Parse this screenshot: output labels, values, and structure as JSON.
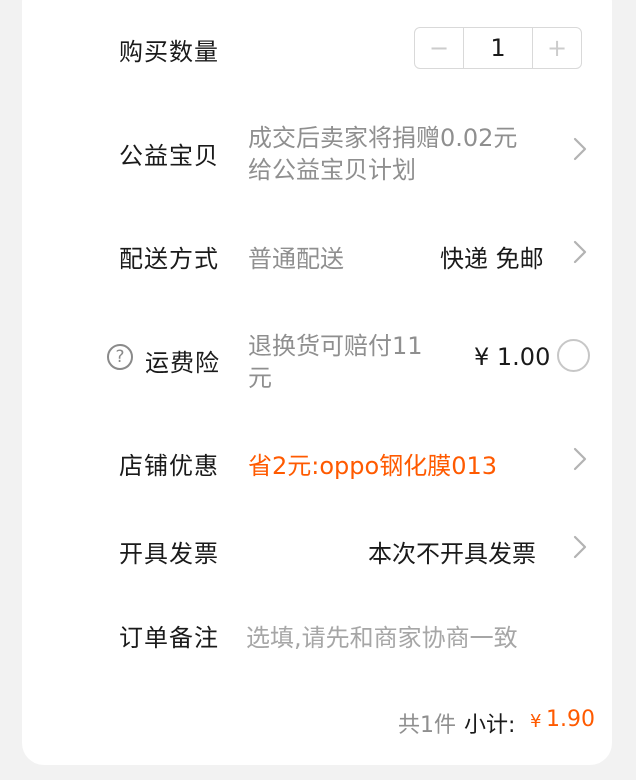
{
  "quantity_row": {
    "label": "购买数量",
    "minus": "−",
    "value": "1",
    "plus": "+"
  },
  "charity_row": {
    "label": "公益宝贝",
    "line1": "成交后卖家将捐赠0.02元",
    "line2": "给公益宝贝计划"
  },
  "delivery_row": {
    "label": "配送方式",
    "method": "普通配送",
    "value": "快递 免邮"
  },
  "insurance_row": {
    "label": "运费险",
    "help_icon": "?",
    "line1": "退换货可赔付11",
    "line2": "元",
    "price": "¥ 1.00",
    "selected": false
  },
  "discount_row": {
    "label": "店铺优惠",
    "value": "省2元:oppo钢化膜013"
  },
  "invoice_row": {
    "label": "开具发票",
    "value": "本次不开具发票"
  },
  "note_row": {
    "label": "订单备注",
    "placeholder": "选填,请先和商家协商一致"
  },
  "summary": {
    "count": "共1件",
    "subtotal_label": "小计:",
    "currency": "¥",
    "amount": "1.90"
  },
  "colors": {
    "accent": "#ff5a00",
    "muted": "#8f8f8f",
    "text": "#1a1a1a"
  }
}
